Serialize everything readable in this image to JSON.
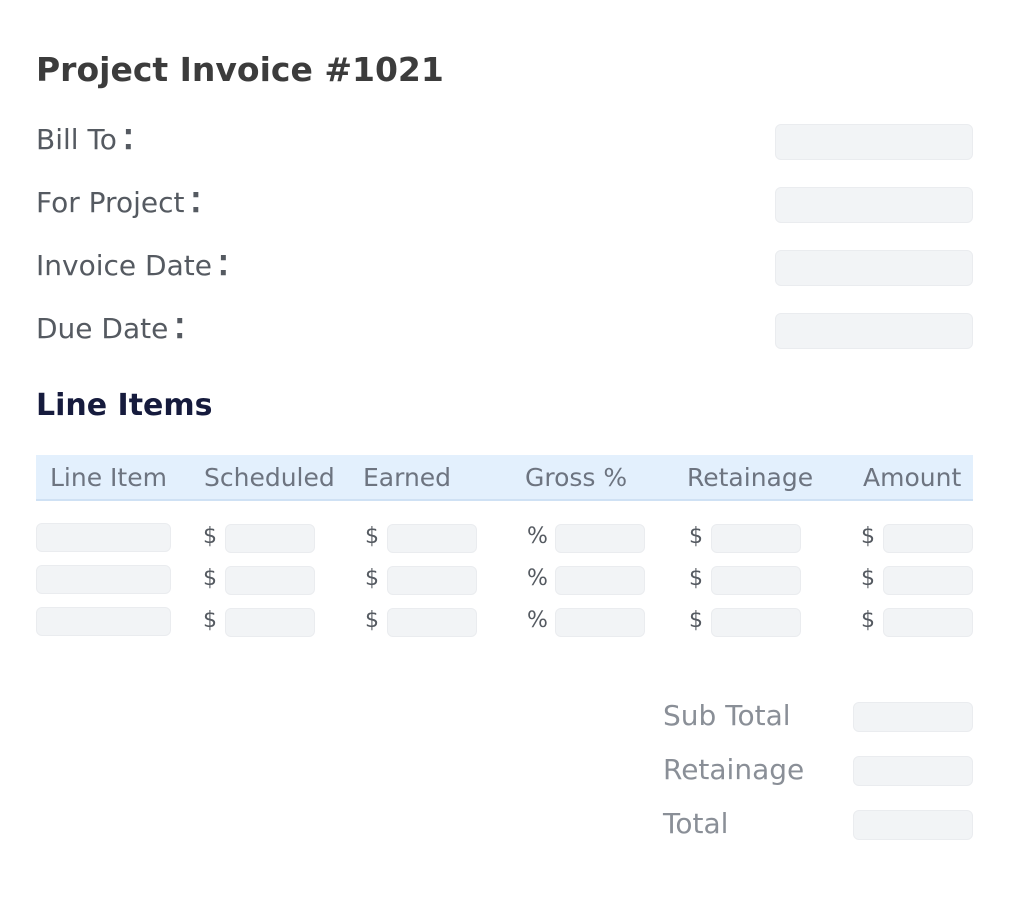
{
  "title": "Project Invoice #1021",
  "fields": [
    {
      "label": "Bill To",
      "value": ""
    },
    {
      "label": "For Project",
      "value": ""
    },
    {
      "label": "Invoice Date",
      "value": ""
    },
    {
      "label": "Due Date",
      "value": ""
    }
  ],
  "field_separator": "⁚",
  "line_items": {
    "title": "Line Items",
    "columns": [
      "Line Item",
      "Scheduled",
      "Earned",
      "Gross %",
      "Retainage",
      "Amount"
    ],
    "symbols": {
      "dollar": "$",
      "percent": "%"
    },
    "rows": [
      {
        "item": "",
        "scheduled": "",
        "earned": "",
        "gross": "",
        "retainage": "",
        "amount": ""
      },
      {
        "item": "",
        "scheduled": "",
        "earned": "",
        "gross": "",
        "retainage": "",
        "amount": ""
      },
      {
        "item": "",
        "scheduled": "",
        "earned": "",
        "gross": "",
        "retainage": "",
        "amount": ""
      }
    ]
  },
  "totals": [
    {
      "label": "Sub Total",
      "value": ""
    },
    {
      "label": "Retainage",
      "value": ""
    },
    {
      "label": "Total",
      "value": ""
    }
  ],
  "colors": {
    "heading": "#3c3c3c",
    "section_heading": "#161b3d",
    "table_header_bg": "#e3f0fd",
    "input_bg": "#f2f4f6"
  }
}
